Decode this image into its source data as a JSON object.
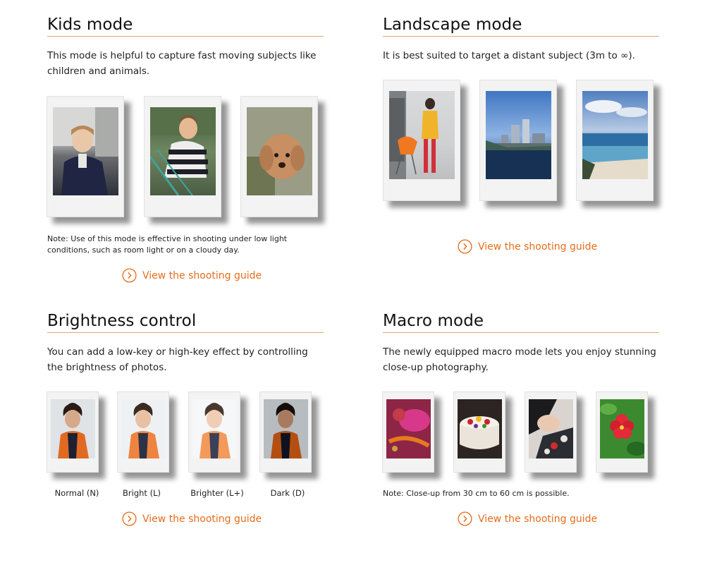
{
  "kids": {
    "title": "Kids mode",
    "description": "This mode is helpful to capture fast moving subjects like children and animals.",
    "note": "Note: Use of this mode is effective in shooting under low light conditions, such as room light or on a cloudy day.",
    "link": "View the shooting guide"
  },
  "landscape": {
    "title": "Landscape mode",
    "description": "It is best suited to target a distant subject (3m to ∞).",
    "link": "View the shooting guide"
  },
  "brightness": {
    "title": "Brightness control",
    "description": "You can add a low-key or high-key effect by controlling the brightness of photos.",
    "captions": [
      "Normal (N)",
      "Bright (L)",
      "Brighter (L+)",
      "Dark (D)"
    ],
    "link": "View the shooting guide"
  },
  "macro": {
    "title": "Macro mode",
    "description": "The newly equipped macro mode lets you enjoy stunning close-up photography.",
    "note": "Note: Close-up from 30 cm to 60 cm is possible.",
    "link": "View the shooting guide"
  },
  "colors": {
    "accent": "#e46d1c",
    "rule": "#e2a66e"
  },
  "icons": {
    "guide_link": "chevron-right-circle-icon"
  }
}
